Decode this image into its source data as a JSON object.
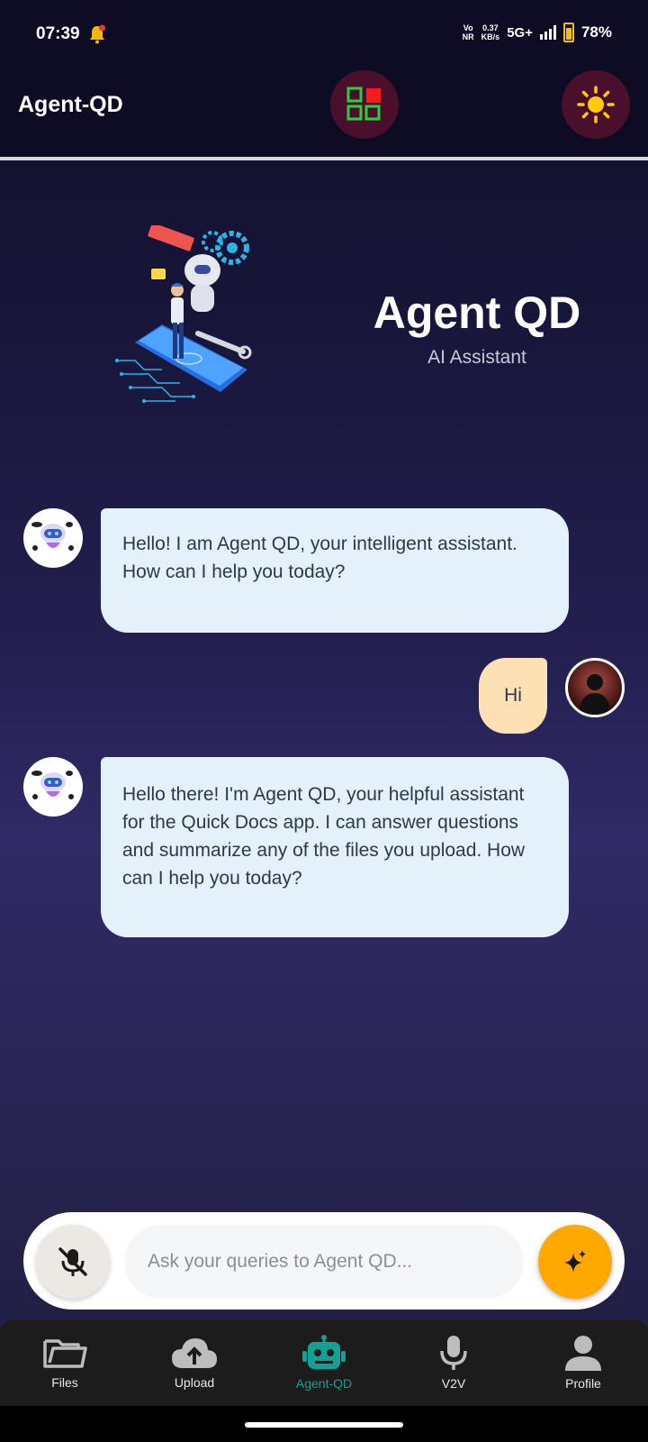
{
  "status_bar": {
    "time": "07:39",
    "network_top": "Vo",
    "network_bottom": "NR",
    "speed_value": "0.37",
    "speed_unit": "KB/s",
    "signal": "5G+",
    "battery": "78%"
  },
  "app_bar": {
    "title": "Agent-QD",
    "apps_icon": "apps-grid-icon",
    "theme_icon": "sun-icon"
  },
  "hero": {
    "title": "Agent QD",
    "subtitle": "AI Assistant"
  },
  "messages": [
    {
      "sender": "bot",
      "text": "Hello! I am Agent QD, your intelligent assistant. How can I help you today?"
    },
    {
      "sender": "user",
      "text": "Hi"
    },
    {
      "sender": "bot",
      "text": "Hello there! I'm Agent QD, your helpful assistant for the Quick Docs app. I can answer questions and summarize any of the files you upload. How can I help you today?"
    }
  ],
  "input": {
    "placeholder": "Ask your queries to Agent QD...",
    "value": ""
  },
  "nav": {
    "items": [
      {
        "label": "Files",
        "icon": "folder-icon"
      },
      {
        "label": "Upload",
        "icon": "cloud-upload-icon"
      },
      {
        "label": "Agent-QD",
        "icon": "robot-icon",
        "active": true
      },
      {
        "label": "V2V",
        "icon": "microphone-icon"
      },
      {
        "label": "Profile",
        "icon": "person-icon"
      }
    ]
  },
  "colors": {
    "accent_active": "#12a192",
    "send_button": "#ffa800",
    "bot_bubble": "#e4f1fb",
    "user_bubble": "#fde1b5",
    "top_button_bg": "#4a0f2a"
  }
}
